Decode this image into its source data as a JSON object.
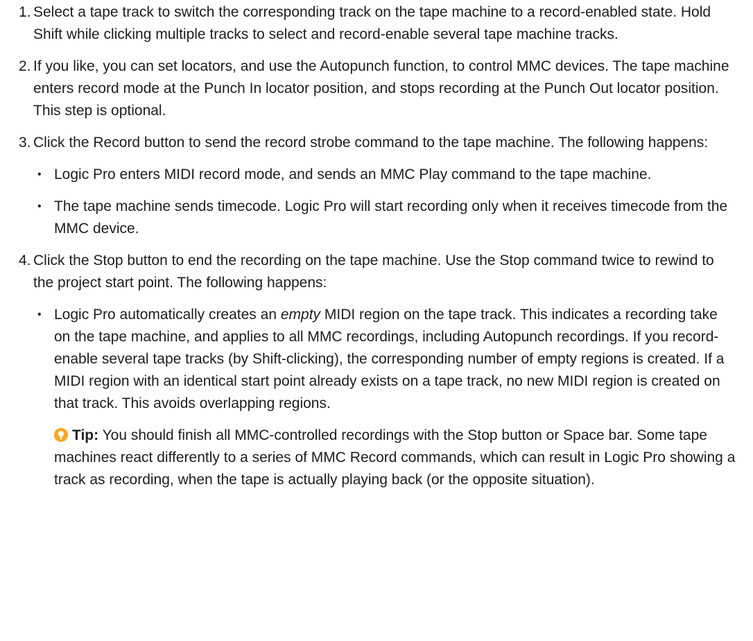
{
  "steps": [
    {
      "number": "1.",
      "text": "Select a tape track to switch the corresponding track on the tape machine to a record-enabled state. Hold Shift while clicking multiple tracks to select and record-enable several tape machine tracks."
    },
    {
      "number": "2.",
      "text": "If you like, you can set locators, and use the Autopunch function, to control MMC devices. The tape machine enters record mode at the Punch In locator position, and stops recording at the Punch Out locator position. This step is optional."
    },
    {
      "number": "3.",
      "text": "Click the Record button to send the record strobe command to the tape machine. The following happens:",
      "bullets": [
        "Logic Pro enters MIDI record mode, and sends an MMC Play command to the tape machine.",
        "The tape machine sends timecode. Logic Pro will start recording only when it receives timecode from the MMC device."
      ]
    },
    {
      "number": "4.",
      "text": "Click the Stop button to end the recording on the tape machine. Use the Stop command twice to rewind to the project start point. The following happens:",
      "bullet": {
        "before": "Logic Pro automatically creates an ",
        "emphasis": "empty",
        "after": " MIDI region on the tape track. This indicates a recording take on the tape machine, and applies to all MMC recordings, including Autopunch recordings. If you record-enable several tape tracks (by Shift-clicking), the corresponding number of empty regions is created. If a MIDI region with an identical start point already exists on a tape track, no new MIDI region is created on that track. This avoids overlapping regions."
      },
      "tip": {
        "icon": "lightbulb-icon",
        "label": "Tip:",
        "text": " You should finish all MMC-controlled recordings with the Stop button or Space bar. Some tape machines react differently to a series of MMC Record commands, which can result in Logic Pro showing a track as recording, when the tape is actually playing back (or the opposite situation)."
      }
    }
  ],
  "bullet_glyph": "•",
  "colors": {
    "text": "#1d1d1f",
    "tip_icon": "#f5a623"
  }
}
